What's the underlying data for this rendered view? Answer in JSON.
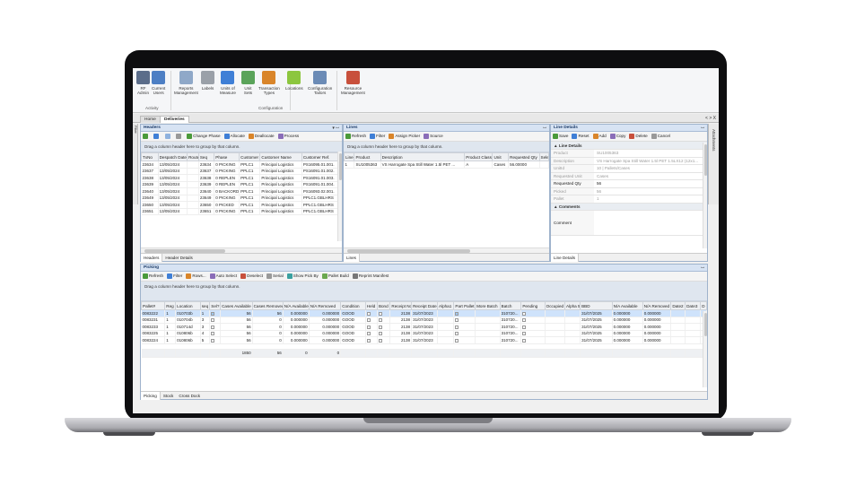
{
  "ribbon": {
    "buttons": [
      {
        "label": "RF\nAdmin",
        "icon": "rf-admin-icon",
        "color": "#5b6d8a"
      },
      {
        "label": "Current\nUsers",
        "icon": "users-icon",
        "color": "#4d7fc4"
      },
      {
        "label": "Reports\nManagement",
        "icon": "reports-icon",
        "color": "#8fa8c8"
      },
      {
        "label": "Labels",
        "icon": "labels-icon",
        "color": "#9aa0a8"
      },
      {
        "label": "Units of\nMeasure",
        "icon": "units-icon",
        "color": "#3f7fd6"
      },
      {
        "label": "Unit\nSets",
        "icon": "unit-sets-icon",
        "color": "#5aa35a"
      },
      {
        "label": "Transaction\nTypes",
        "icon": "transaction-icon",
        "color": "#d9852a"
      },
      {
        "label": "Locations",
        "icon": "locations-icon",
        "color": "#8cc63f"
      },
      {
        "label": "Configuration\nTailors",
        "icon": "config-icon",
        "color": "#6b8bb6"
      },
      {
        "label": "Resource\nManagement",
        "icon": "resource-icon",
        "color": "#c8503c"
      }
    ],
    "groups": {
      "activity": "Activity",
      "configuration": "Configuration"
    }
  },
  "tabs": {
    "home": "Home",
    "deliveries": "Deliveries",
    "controls": "< > X"
  },
  "side": {
    "left": "Filter",
    "right": "Attachments"
  },
  "headers": {
    "title": "Headers",
    "toolbar": [
      "Change Phase",
      "Allocate",
      "Deallocate",
      "Process"
    ],
    "group_hint": "Drag a column header here to group by that column.",
    "columns": [
      "TxNo",
      "Despatch Date",
      "Route",
      "Seq",
      "Phase",
      "Customer",
      "Customer Name",
      "Customer Ref."
    ],
    "rows": [
      [
        "23634",
        "13/05/2024",
        "",
        "23634",
        "0 PICKING",
        "PPLC1",
        "Principal Logistics",
        "PS16095.01.001."
      ],
      [
        "23637",
        "13/05/2024",
        "",
        "23637",
        "0 PICKING",
        "PPLC1",
        "Principal Logistics",
        "PS16091.01.002."
      ],
      [
        "23638",
        "13/05/2024",
        "",
        "23638",
        "0 REPLEN",
        "PPLC1",
        "Principal Logistics",
        "PS16091.01.003."
      ],
      [
        "23639",
        "13/05/2024",
        "",
        "23639",
        "0 REPLEN",
        "PPLC1",
        "Principal Logistics",
        "PS16091.01.004."
      ],
      [
        "23640",
        "13/05/2024",
        "",
        "23640",
        "0 BACKORD",
        "PPLC1",
        "Principal Logistics",
        "PS16093.02.001."
      ],
      [
        "23649",
        "13/05/2024",
        "",
        "23649",
        "0 PICKING",
        "PPLC1",
        "Principal Logistics",
        "PPLC1.GBLHRS"
      ],
      [
        "23650",
        "13/05/2024",
        "",
        "23650",
        "0 PICKED",
        "PPLC1",
        "Principal Logistics",
        "PPLC1.GBLHRS"
      ],
      [
        "23651",
        "13/05/2024",
        "",
        "23651",
        "0 PICKING",
        "PPLC1",
        "Principal Logistics",
        "PPLC1.GBLHRS"
      ]
    ],
    "tabs": [
      "Headers",
      "Header Details"
    ]
  },
  "lines": {
    "title": "Lines",
    "toolbar": [
      "Refresh",
      "Filter",
      "Assign Picker",
      "Source"
    ],
    "group_hint": "Drag a column header here to group by that column.",
    "columns": [
      "Line",
      "Product",
      "Description",
      "Product Class",
      "Unit",
      "Requested Qty",
      "Sele"
    ],
    "rows": [
      [
        "1",
        "SU1005363",
        "VS Harrogate Spa Still Water 1.5l PET ...",
        "A",
        "Cases",
        "56.00000",
        ""
      ]
    ],
    "tabs": [
      "Lines"
    ]
  },
  "line_details": {
    "title": "Line Details",
    "toolbar": [
      "Save",
      "Reset",
      "Add",
      "Copy",
      "Delete",
      "Cancel"
    ],
    "section_main": "Line Details",
    "fields": [
      {
        "k": "Product",
        "v": "SU1005363",
        "dim": true
      },
      {
        "k": "Description",
        "v": "VS Harrogate Spa Still Water 1.5l PET 1.5LX12 (12x1...",
        "dim": true
      },
      {
        "k": "UnitId",
        "v": "10 | Pallets/Cases",
        "dim": true
      },
      {
        "k": "Requested Unit",
        "v": "Cases",
        "dim": true
      },
      {
        "k": "Requested Qty",
        "v": "56",
        "dim": false
      },
      {
        "k": "Picked",
        "v": "56",
        "dim": true
      },
      {
        "k": "Pallet",
        "v": "1",
        "dim": true
      }
    ],
    "section_comments": "Comments",
    "comment_label": "Comment",
    "tabs": [
      "Line Details"
    ]
  },
  "picking": {
    "title": "Picking",
    "toolbar": [
      "Refresh",
      "Filter",
      "Rows...",
      "Auto Select",
      "Deselect",
      "Serial",
      "Show Pick By",
      "Pallet Build",
      "Reprint Manifest"
    ],
    "group_hint": "Drag a column header here to group by that column.",
    "columns": [
      "Pallet#",
      "Reg",
      "Location",
      "seq",
      "Sel?",
      "Cases Available",
      "Cases Removed",
      "N/A Available",
      "N/A Removed",
      "Condition",
      "Held",
      "Bond",
      "Receipt No",
      "Receipt Date",
      "Alpha1",
      "Part Pallet",
      "More Batch",
      "Batch",
      "Pending",
      "Occupied",
      "Alpha 5",
      "BBD",
      "N/A Available",
      "N/A Removed",
      "Date2",
      "Date3",
      "D"
    ],
    "rows": [
      {
        "cells": [
          "0083222",
          "1",
          "010703b",
          "1",
          "",
          "56",
          "56",
          "0.000000",
          "0.000000",
          "GOOD",
          "",
          "",
          "2138",
          "31/07/2023",
          "",
          "",
          "",
          "310720...",
          "",
          "",
          "",
          "31/07/2025",
          "0.000000",
          "0.000000",
          "",
          "",
          ""
        ],
        "checked": true,
        "selected": true
      },
      {
        "cells": [
          "0083231",
          "1",
          "010704b",
          "3",
          "",
          "56",
          "0",
          "0.000000",
          "0.000000",
          "GOOD",
          "",
          "",
          "2138",
          "31/07/2023",
          "",
          "",
          "",
          "310720...",
          "",
          "",
          "",
          "31/07/2025",
          "0.000000",
          "0.000000",
          "",
          "",
          ""
        ],
        "checked": false,
        "selected": false
      },
      {
        "cells": [
          "0083233",
          "1",
          "010714d",
          "3",
          "",
          "56",
          "0",
          "0.000000",
          "0.000000",
          "GOOD",
          "",
          "",
          "2138",
          "31/07/2023",
          "",
          "",
          "",
          "310720...",
          "",
          "",
          "",
          "31/07/2025",
          "0.000000",
          "0.000000",
          "",
          "",
          ""
        ],
        "checked": false,
        "selected": false
      },
      {
        "cells": [
          "0083225",
          "1",
          "010806b",
          "4",
          "",
          "56",
          "0",
          "0.000000",
          "0.000000",
          "GOOD",
          "",
          "",
          "2138",
          "31/07/2023",
          "",
          "",
          "",
          "310720...",
          "",
          "",
          "",
          "31/07/2025",
          "0.000000",
          "0.000000",
          "",
          "",
          ""
        ],
        "checked": false,
        "selected": false
      },
      {
        "cells": [
          "0083224",
          "1",
          "010806b",
          "5",
          "",
          "56",
          "0",
          "0.000000",
          "0.000000",
          "GOOD",
          "",
          "",
          "2138",
          "31/07/2023",
          "",
          "",
          "",
          "310720...",
          "",
          "",
          "",
          "31/07/2025",
          "0.000000",
          "0.000000",
          "",
          "",
          ""
        ],
        "checked": false,
        "selected": false
      }
    ],
    "totals": {
      "cases_available": "1850",
      "cases_removed": "56",
      "na_available": "0",
      "na_removed": "0"
    },
    "tabs": [
      "Picking",
      "Stock",
      "Cross Dock"
    ]
  }
}
